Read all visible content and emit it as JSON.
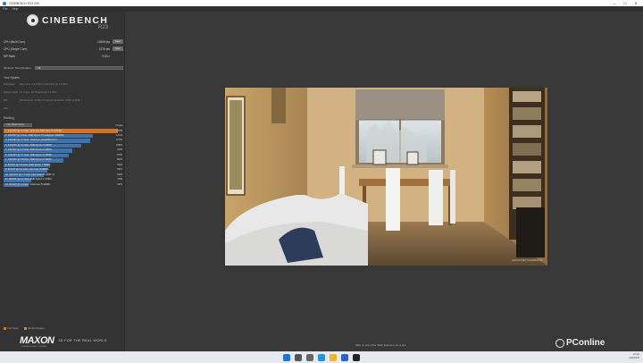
{
  "window": {
    "title": "CINEBENCH R23.200",
    "controls": [
      "—",
      "☐",
      "✕"
    ]
  },
  "menu": [
    "File",
    "Help"
  ],
  "brand": {
    "name": "CINEBENCH",
    "version": "R23"
  },
  "scores": [
    {
      "label": "CPU (Multi Core)",
      "value": "15508 pts",
      "button": "Start"
    },
    {
      "label": "CPU (Single Core)",
      "value": "1578 pts",
      "button": "Start"
    },
    {
      "label": "MP Ratio",
      "value": "9.83 x",
      "button": ""
    }
  ],
  "min_duration": {
    "label": "Minimum Test Duration",
    "value": "Off"
  },
  "system": {
    "title": "Your System",
    "rows": [
      {
        "key": "Processor",
        "value": "Intel Core i7-12700H (14C/20T) @ 2.3 GHz"
      },
      {
        "key": "Cores x GHz",
        "value": "14 Cores, 20 Threads @ 2.3 GHz"
      },
      {
        "key": "OS",
        "value": "Windows 10, 64 Bit, Professional Edition (build 22000)"
      },
      {
        "key": "Info",
        "value": ""
      }
    ]
  },
  "ranking": {
    "title": "Ranking",
    "selector": "CPU (Multi Core)",
    "details_label": "Details",
    "items": [
      {
        "label": "1. 14C/20T @ 2.3 GHz, 12th Gen Intel Core i7-12700H",
        "score": "15508",
        "pct": 1.0,
        "color": "#d7701f"
      },
      {
        "label": "2. 32C/64T @ 3 GHz, AMD Ryzen Threadripper 2990WX",
        "score": "12134",
        "pct": 0.78,
        "color": "#3f73ad"
      },
      {
        "label": "3. 24C/48T @ 2.7 GHz, Intel Xeon W-3265M CPU",
        "score": "11763",
        "pct": 0.76,
        "color": "#3f73ad"
      },
      {
        "label": "4. 16C/32T @ 3.4 GHz, AMD Ryzen 9 5950X",
        "score": "10563",
        "pct": 0.68,
        "color": "#3f73ad"
      },
      {
        "label": "5. 16C/32T @ 3.4 GHz, AMD Ryzen 9 3950X",
        "score": "9300",
        "pct": 0.6,
        "color": "#3f73ad"
      },
      {
        "label": "6. 12C/24T @ 3.7 GHz, AMD Ryzen 9 5900X",
        "score": "8781",
        "pct": 0.57,
        "color": "#3f73ad"
      },
      {
        "label": "7. 12C/24T @ 3.8 GHz, AMD Ryzen 9 3900X",
        "score": "8000",
        "pct": 0.52,
        "color": "#3f73ad"
      },
      {
        "label": "8. 8C/16T @ 3.8 GHz, AMD Ryzen 7 5800X",
        "score": "6302",
        "pct": 0.41,
        "color": "#3f73ad"
      },
      {
        "label": "9. 8C/16T @ 3.6 GHz, Intel Core i9-9900K",
        "score": "5915",
        "pct": 0.38,
        "color": "#3f73ad"
      },
      {
        "label": "10. 12C/24T @ 2.7 GHz, Intel Xeon E5-2697 v2",
        "score": "5426",
        "pct": 0.35,
        "color": "#3f73ad"
      },
      {
        "label": "11. 8C/16T @ 3.4 GHz, AMD Ryzen 7 1700X",
        "score": "3755",
        "pct": 0.24,
        "color": "#3f73ad"
      },
      {
        "label": "12. 6C/12T @ 2.9 GHz, Intel Core i5-10400",
        "score": "3379",
        "pct": 0.22,
        "color": "#3f73ad"
      }
    ]
  },
  "legend": [
    {
      "label": "Your Score",
      "color": "#d7701f"
    },
    {
      "label": "Identical System",
      "color": "#c88a3a"
    }
  ],
  "maxon": {
    "logo": "MAXON",
    "tagline": "3D FOR THE REAL WORLD",
    "sub": "A NEMETSCHEK COMPANY"
  },
  "render_watermark": "MAXON.NET/CINEBENCH",
  "status_text": "Click on one of the 'Start' buttons to run a test.",
  "watermark": "PConline",
  "taskbar_icons": [
    {
      "name": "windows-start-icon",
      "color": "#1a73d9"
    },
    {
      "name": "search-icon",
      "color": "#555555"
    },
    {
      "name": "task-view-icon",
      "color": "#666666"
    },
    {
      "name": "edge-browser-icon",
      "color": "#1f9ad6"
    },
    {
      "name": "file-explorer-icon",
      "color": "#f0b429"
    },
    {
      "name": "store-icon",
      "color": "#2563c9"
    },
    {
      "name": "cinebench-icon",
      "color": "#222222"
    }
  ],
  "tray": {
    "time": "10:22",
    "date": "2022/1/5"
  }
}
